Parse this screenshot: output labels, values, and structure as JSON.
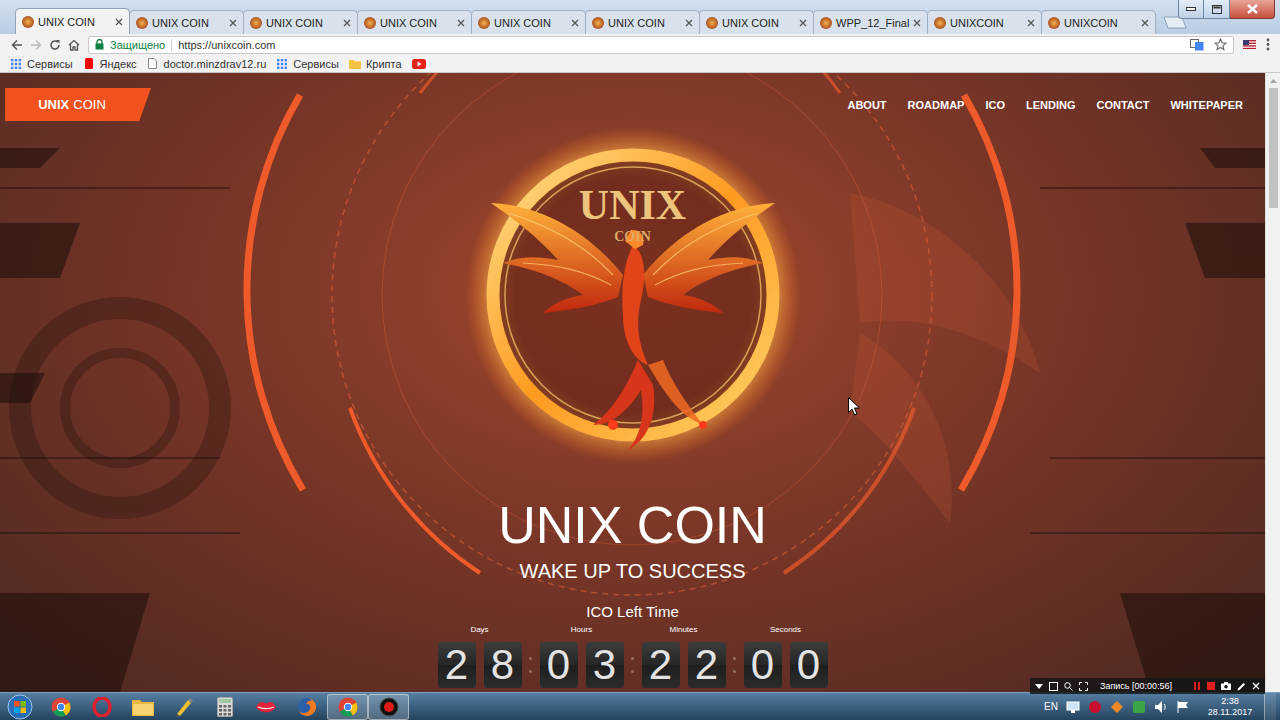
{
  "browser": {
    "tabs": [
      {
        "label": "UNIX COIN",
        "selected": true
      },
      {
        "label": "UNIX COIN",
        "selected": false
      },
      {
        "label": "UNIX COIN",
        "selected": false
      },
      {
        "label": "UNIX COIN",
        "selected": false
      },
      {
        "label": "UNIX COIN",
        "selected": false
      },
      {
        "label": "UNIX COIN",
        "selected": false
      },
      {
        "label": "UNIX COIN",
        "selected": false
      },
      {
        "label": "WPP_12_Final",
        "selected": false
      },
      {
        "label": "UNIXCOIN",
        "selected": false
      },
      {
        "label": "UNIXCOIN",
        "selected": false
      }
    ],
    "security": "Защищено",
    "url": "https://unixcoin.com",
    "bookmarks": [
      {
        "label": "Сервисы",
        "kind": "apps"
      },
      {
        "label": "Яндекс",
        "kind": "yandex"
      },
      {
        "label": "doctor.minzdrav12.ru",
        "kind": "page"
      },
      {
        "label": "Сервисы",
        "kind": "apps"
      },
      {
        "label": "Крипта",
        "kind": "folder"
      }
    ]
  },
  "page": {
    "brand": {
      "bold": "UNIX",
      "light": "COIN"
    },
    "nav": [
      {
        "label": "ABOUT"
      },
      {
        "label": "ROADMAP"
      },
      {
        "label": "ICO"
      },
      {
        "label": "LENDING"
      },
      {
        "label": "CONTACT"
      },
      {
        "label": "WHITEPAPER"
      }
    ],
    "logo": {
      "top": "UNIX",
      "bottom": "COIN"
    },
    "title": "UNIX COIN",
    "tagline": "WAKE UP TO SUCCESS",
    "countdown": {
      "label": "ICO Left Time",
      "units": [
        {
          "label": "Days",
          "digits": [
            "2",
            "8"
          ]
        },
        {
          "label": "Hours",
          "digits": [
            "0",
            "3"
          ]
        },
        {
          "label": "Minutes",
          "digits": [
            "2",
            "2"
          ]
        },
        {
          "label": "Seconds",
          "digits": [
            "0",
            "0"
          ]
        }
      ]
    }
  },
  "recorder": {
    "label": "Запись [00:00:56]"
  },
  "taskbar": {
    "apps": [
      {
        "kind": "chrome",
        "active": false
      },
      {
        "kind": "opera",
        "active": false
      },
      {
        "kind": "explorer",
        "active": false
      },
      {
        "kind": "tool",
        "active": false
      },
      {
        "kind": "calculator",
        "active": false
      },
      {
        "kind": "lips",
        "active": false
      },
      {
        "kind": "firefox",
        "active": false
      },
      {
        "kind": "chrome",
        "active": true
      },
      {
        "kind": "recorder",
        "active": true
      }
    ],
    "language": "EN",
    "time": "2:38",
    "date": "28.11.2017"
  }
}
